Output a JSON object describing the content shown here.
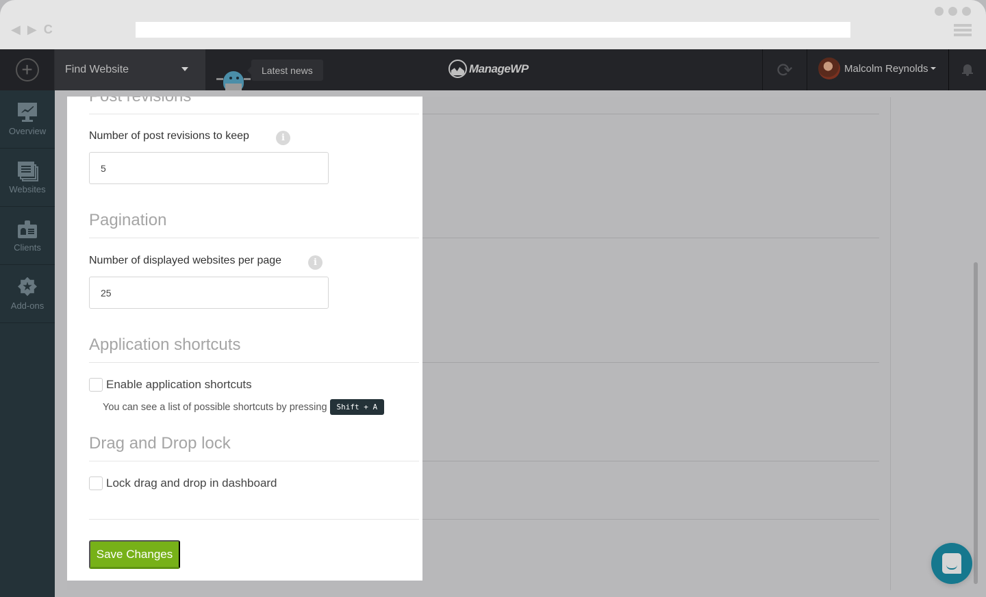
{
  "browser": {
    "back_icon": "◀",
    "forward_icon": "▶",
    "reload_icon": "C",
    "url": ""
  },
  "header": {
    "add_icon": "+",
    "find_website": "Find Website",
    "latest_news": "Latest news",
    "logo_text": "ManageWP",
    "sync_icon": "⟳",
    "user_name": "Malcolm Reynolds"
  },
  "sidebar": {
    "items": [
      {
        "label": "Overview",
        "icon": "monitor-chart-icon"
      },
      {
        "label": "Websites",
        "icon": "list-pages-icon"
      },
      {
        "label": "Clients",
        "icon": "id-badge-icon"
      },
      {
        "label": "Add-ons",
        "icon": "star-badge-icon"
      }
    ]
  },
  "settings": {
    "post_revisions": {
      "title": "Post revisions",
      "label": "Number of post revisions to keep",
      "value": "5"
    },
    "pagination": {
      "title": "Pagination",
      "label": "Number of displayed websites per page",
      "value": "25"
    },
    "shortcuts": {
      "title": "Application shortcuts",
      "checkbox_label": "Enable application shortcuts",
      "checked": false,
      "hint": "You can see a list of possible shortcuts by pressing",
      "key": "Shift + A"
    },
    "drag_drop": {
      "title": "Drag and Drop lock",
      "checkbox_label": "Lock drag and drop in dashboard",
      "checked": false
    },
    "save_label": "Save Changes",
    "info_icon": "i"
  },
  "colors": {
    "accent_green": "#77b118",
    "sidebar_bg": "#243238",
    "header_bg": "#232428",
    "chat_teal": "#16788e"
  }
}
